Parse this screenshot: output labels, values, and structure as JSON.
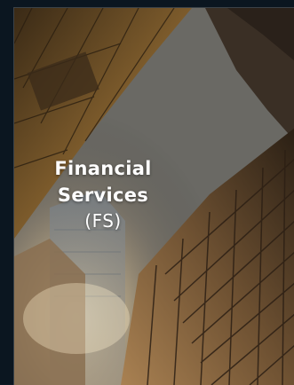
{
  "card": {
    "title_line1": "Financial",
    "title_line2": "Services",
    "abbreviation": "(FS)",
    "image_icon": "skyscrapers-photo"
  },
  "colors": {
    "background": "#0b1620",
    "caption_text": "#ffffff",
    "border": "#3b4248"
  }
}
